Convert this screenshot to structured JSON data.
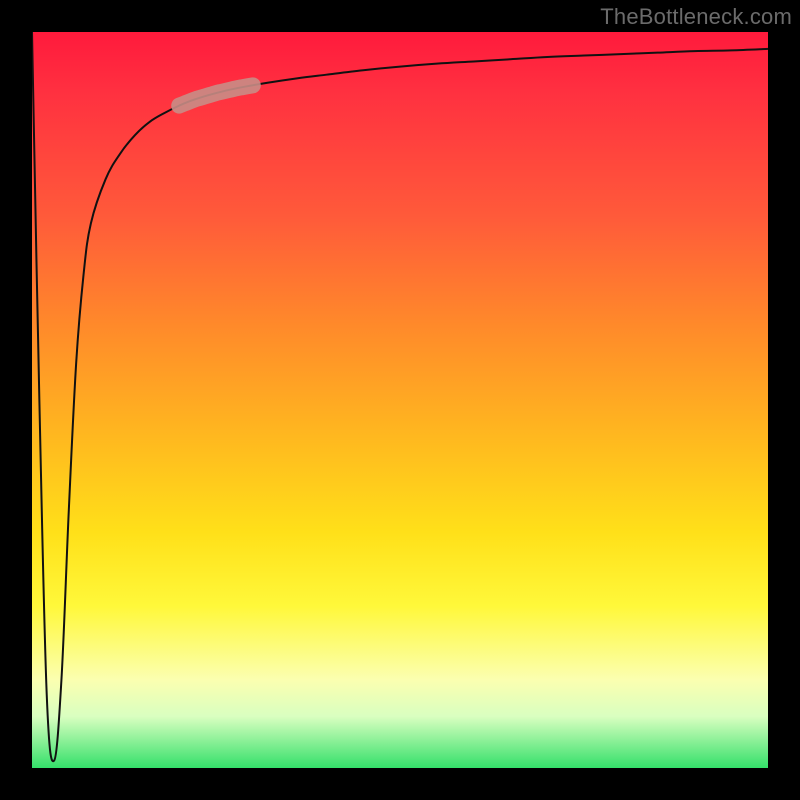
{
  "watermark": {
    "text": "TheBottleneck.com"
  },
  "colors": {
    "curve": "#111111",
    "highlight_fill": "#c98d86",
    "highlight_stroke": "#c98d86"
  },
  "chart_data": {
    "type": "line",
    "title": "",
    "xlabel": "",
    "ylabel": "",
    "xlim": [
      0,
      100
    ],
    "ylim": [
      0,
      100
    ],
    "grid": false,
    "x": [
      0,
      1,
      2,
      3,
      4,
      5,
      6,
      7,
      8,
      10,
      12,
      14,
      16,
      18,
      20,
      22,
      25,
      28,
      32,
      36,
      40,
      45,
      50,
      55,
      60,
      65,
      70,
      75,
      80,
      85,
      90,
      95,
      100
    ],
    "values": [
      100,
      50,
      10,
      1,
      12,
      35,
      55,
      67,
      74,
      80,
      83.5,
      86,
      87.8,
      89,
      90,
      90.8,
      91.7,
      92.4,
      93.1,
      93.7,
      94.2,
      94.8,
      95.3,
      95.7,
      96.0,
      96.3,
      96.6,
      96.8,
      97.0,
      97.2,
      97.4,
      97.5,
      97.7
    ],
    "highlight_segment": {
      "x_start": 20,
      "x_end": 30,
      "note": "muted-pink thick capsule segment overlaid on the curve"
    },
    "annotations": []
  }
}
